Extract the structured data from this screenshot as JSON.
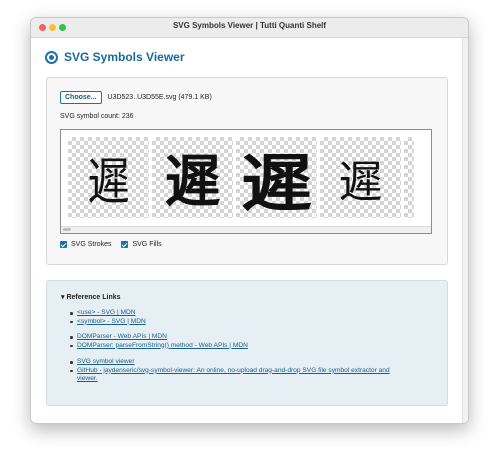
{
  "window": {
    "title": "SVG Symbols Viewer | Tutti Quanti Shelf"
  },
  "header": {
    "title": "SVG Symbols Viewer"
  },
  "file": {
    "choose_label": "Choose...",
    "file_info": "U3D523..U3D55E.svg (479.1 KB)"
  },
  "symbols": {
    "count_text": "SVG symbol count: 236",
    "glyphs": [
      "遲",
      "遲",
      "遲",
      "遲"
    ]
  },
  "options": {
    "strokes_label": "SVG Strokes",
    "strokes_checked": true,
    "fills_label": "SVG Fills",
    "fills_checked": true
  },
  "references": {
    "summary": "▾ Reference Links",
    "groups": [
      [
        "<use> - SVG | MDN",
        "<symbol> - SVG | MDN"
      ],
      [
        "DOMParser - Web APIs | MDN",
        "DOMParser: parseFromString() method - Web APIs | MDN"
      ],
      [
        "SVG symbol viewer",
        "GitHub - jaydenseric/svg-symbol-viewer: An online, no-upload drag-and-drop SVG file symbol extractor and viewer."
      ]
    ]
  },
  "colors": {
    "accent": "#1b72a5",
    "title": "#1a6a98",
    "link": "#1a5e8a",
    "refs_bg": "#e5eff4"
  }
}
